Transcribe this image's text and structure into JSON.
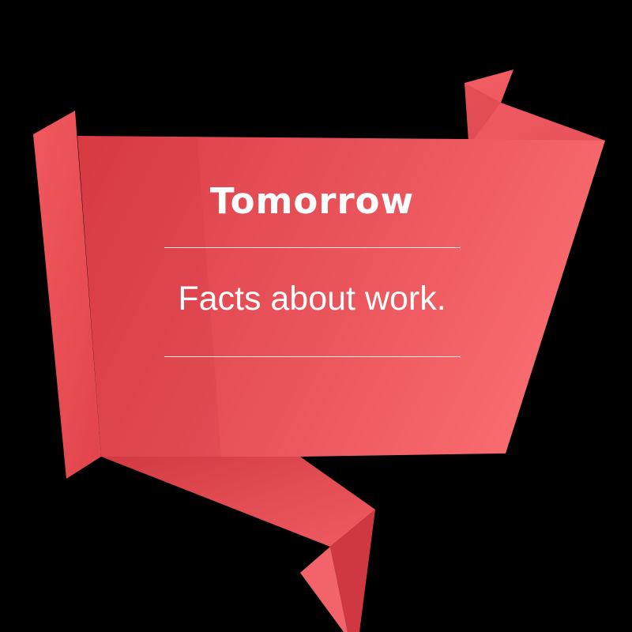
{
  "banner": {
    "title": "Tomorrow",
    "subtitle": "Facts about work."
  },
  "colors": {
    "background": "#000000",
    "banner_main": "#e64a52",
    "banner_light": "#f4686c",
    "banner_dark": "#c8343c",
    "text": "#ffffff"
  }
}
